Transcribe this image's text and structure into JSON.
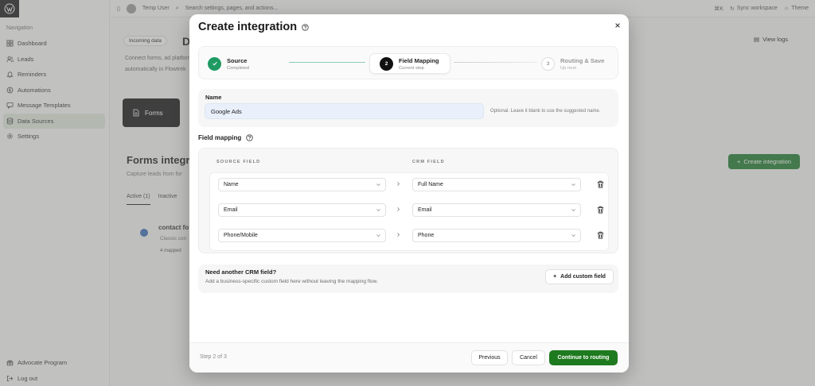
{
  "sidebar": {
    "section_title": "Navigation",
    "items": [
      {
        "label": "Dashboard",
        "icon": "grid-icon"
      },
      {
        "label": "Leads",
        "icon": "users-icon"
      },
      {
        "label": "Reminders",
        "icon": "bell-icon"
      },
      {
        "label": "Automations",
        "icon": "bolt-icon"
      },
      {
        "label": "Message Templates",
        "icon": "message-icon"
      },
      {
        "label": "Data Sources",
        "icon": "database-icon",
        "active": true
      },
      {
        "label": "Settings",
        "icon": "gear-icon"
      }
    ],
    "bottom_items": [
      {
        "label": "Advocate Program",
        "icon": "gift-icon"
      },
      {
        "label": "Log out",
        "icon": "logout-icon"
      }
    ]
  },
  "topbar": {
    "user": "Temp User",
    "search_placeholder": "Search settings, pages, and actions...",
    "shortcut": "⌘K",
    "sync_label": "Sync workspace",
    "theme_label": "Theme"
  },
  "background": {
    "chip": "Incoming data",
    "heading_letter": "D",
    "desc_line1": "Connect forms, ad platforms and",
    "desc_line2": "automatically in Flowtrek",
    "forms_card": "Forms",
    "section_title": "Forms integr",
    "section_sub": "Capture leads from for",
    "tab_active": "Active (1)",
    "tab_inactive": "Inactive",
    "row_title": "contact fo",
    "row_sub": "Classic con",
    "mapped": "4 mapped",
    "view_logs": "View logs",
    "create_button": "Create integration"
  },
  "modal": {
    "title": "Create integration",
    "steps": [
      {
        "label": "Source",
        "sub": "Completed",
        "state": "done"
      },
      {
        "label": "Field Mapping",
        "sub": "Current step",
        "number": "2",
        "state": "current"
      },
      {
        "label": "Routing & Save",
        "sub": "Up next",
        "number": "3",
        "state": "upcoming"
      }
    ],
    "name_label": "Name",
    "name_value": "Google Ads",
    "name_hint": "Optional. Leave it blank to use the suggested name.",
    "field_mapping_title": "Field mapping",
    "source_header": "SOURCE FIELD",
    "crm_header": "CRM FIELD",
    "mappings": [
      {
        "source": "Name",
        "crm": "Full Name"
      },
      {
        "source": "Email",
        "crm": "Email"
      },
      {
        "source": "Phone/Mobile",
        "crm": "Phone"
      }
    ],
    "custom_title": "Need another CRM field?",
    "custom_sub": "Add a business-specific custom field here without leaving the mapping flow.",
    "add_custom_label": "Add custom field",
    "footer": {
      "step_count": "Step 2 of 3",
      "previous": "Previous",
      "cancel": "Cancel",
      "next": "Continue to routing"
    }
  },
  "colors": {
    "accent_green": "#1e7a1e",
    "step_done": "#1f9a63",
    "input_bg": "#eaf0fb"
  }
}
